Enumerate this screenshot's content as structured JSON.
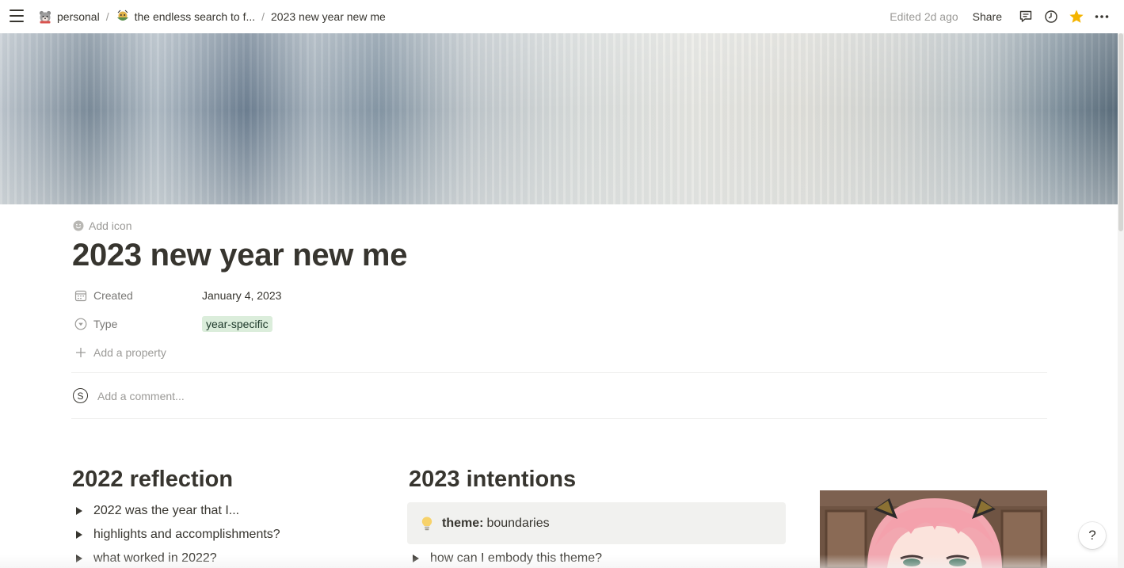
{
  "breadcrumb": [
    {
      "label": "personal",
      "icon": "bear-emoji-icon"
    },
    {
      "label": "the endless search to f...",
      "icon": "bowl-emoji-icon"
    },
    {
      "label": "2023 new year new me"
    }
  ],
  "topbar": {
    "edited": "Edited 2d ago",
    "share_label": "Share",
    "icons": [
      "comment-icon",
      "clock-history-icon",
      "star-icon",
      "more-icon"
    ],
    "star_color": "#f4b400"
  },
  "page": {
    "add_icon_label": "Add icon",
    "title": "2023 new year new me",
    "properties": [
      {
        "name": "Created",
        "icon": "calendar-icon",
        "value": "January 4, 2023"
      },
      {
        "name": "Type",
        "icon": "select-icon",
        "value": "year-specific",
        "tag_color": "#dbeddb"
      }
    ],
    "add_property_label": "Add a property",
    "comment_avatar": "S",
    "comment_placeholder": "Add a comment..."
  },
  "reflection": {
    "heading": "2022 reflection",
    "toggles": [
      "2022 was the year that I...",
      "highlights and accomplishments?",
      "what worked in 2022?"
    ]
  },
  "intentions": {
    "heading": "2023 intentions",
    "callout_icon": "lightbulb-icon",
    "callout_bold": "theme:",
    "callout_text": "boundaries",
    "toggles": [
      "how can I embody this theme?"
    ]
  },
  "help_label": "?"
}
